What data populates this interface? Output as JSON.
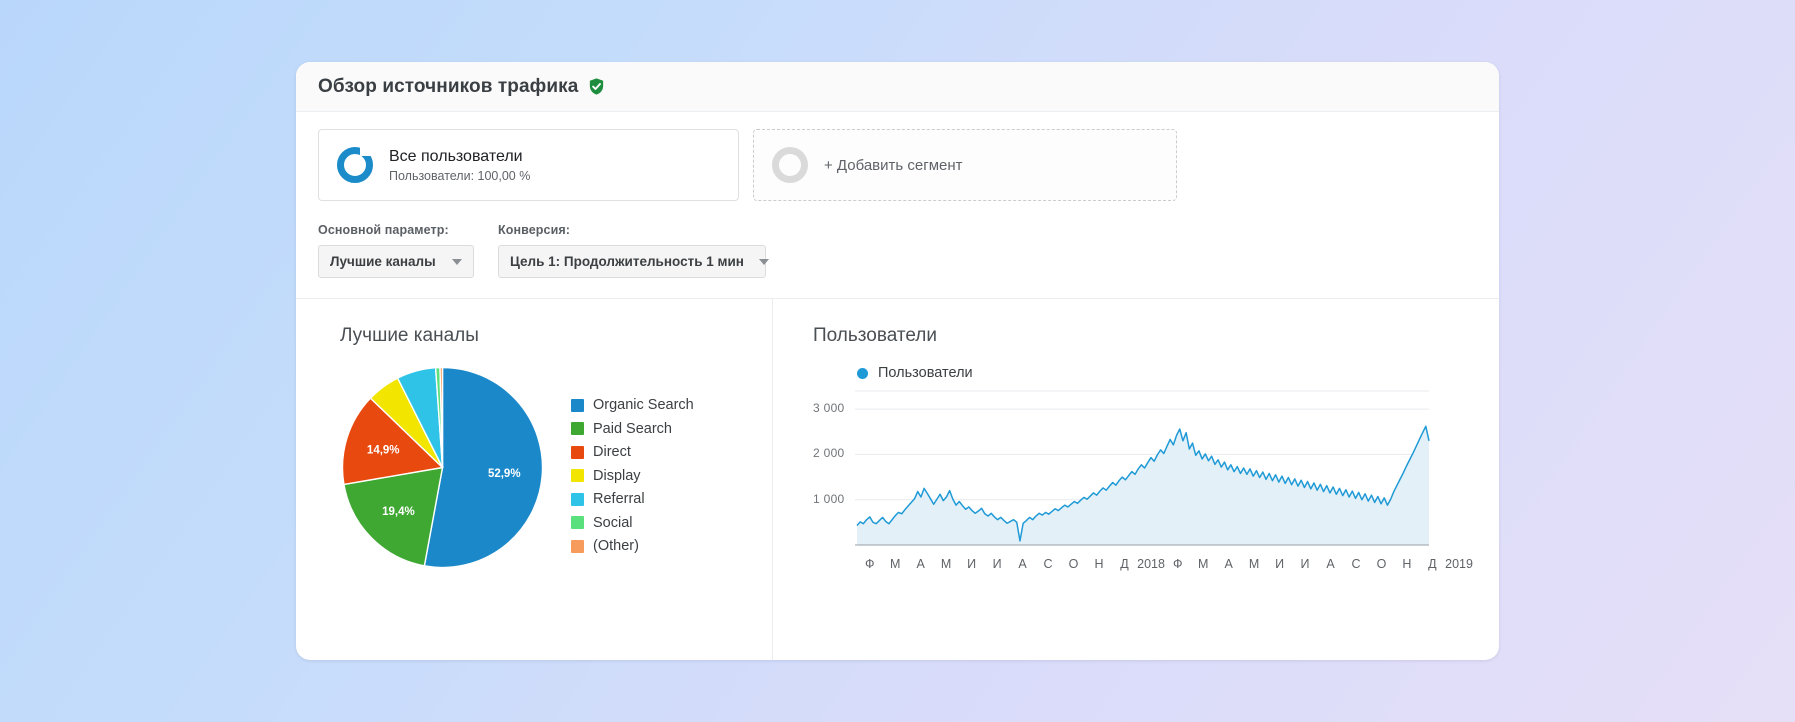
{
  "header": {
    "title": "Обзор источников трафика",
    "badge_icon": "verified-shield-icon",
    "badge_color": "#1e8e3e"
  },
  "segments": [
    {
      "name": "Все пользователи",
      "subtitle": "Пользователи: 100,00 %",
      "icon": "donut-chart-icon",
      "color": "#1b8bc9"
    },
    {
      "add_label": "+ Добавить сегмент",
      "icon": "donut-chart-icon",
      "color": "#dadada"
    }
  ],
  "controls": {
    "primary": {
      "label": "Основной параметр:",
      "value": "Лучшие каналы",
      "caret_icon": "chevron-down-icon"
    },
    "conversion": {
      "label": "Конверсия:",
      "value": "Цель 1: Продолжительность 1 мин",
      "caret_icon": "chevron-down-icon"
    }
  },
  "panels": {
    "pie_title": "Лучшие каналы",
    "line_title": "Пользователи"
  },
  "chart_data": [
    {
      "type": "pie",
      "title": "Лучшие каналы",
      "legend_position": "right",
      "categories": [
        "Organic Search",
        "Paid Search",
        "Direct",
        "Display",
        "Referral",
        "Social",
        "(Other)"
      ],
      "values": [
        52.9,
        19.4,
        14.9,
        5.4,
        6.3,
        0.7,
        0.4
      ],
      "colors": [
        "#1a88c9",
        "#3fa832",
        "#e8490f",
        "#f2e500",
        "#2fc3e8",
        "#5ae07c",
        "#f79b5c"
      ],
      "value_labels": [
        "52,9%",
        "19,4%",
        "14,9%",
        "",
        "",
        "",
        ""
      ],
      "labels_shown": [
        "52,9%",
        "19,4%",
        "14,9%"
      ]
    },
    {
      "type": "area",
      "title": "Пользователи",
      "legend": [
        "Пользователи"
      ],
      "legend_color": "#1f9ad6",
      "ylabel": "",
      "xlabel": "",
      "ylim": [
        0,
        3400
      ],
      "yticks": [
        "1 000",
        "2 000",
        "3 000"
      ],
      "ytick_values": [
        1000,
        2000,
        3000
      ],
      "grid": true,
      "xticks": [
        "Ф",
        "М",
        "А",
        "М",
        "И",
        "И",
        "А",
        "С",
        "О",
        "Н",
        "Д",
        "2018",
        "Ф",
        "М",
        "А",
        "М",
        "И",
        "И",
        "А",
        "С",
        "О",
        "Н",
        "Д",
        "2019"
      ],
      "series": [
        {
          "name": "Пользователи",
          "values": [
            430,
            510,
            470,
            560,
            620,
            500,
            470,
            540,
            610,
            520,
            470,
            560,
            650,
            720,
            690,
            780,
            860,
            940,
            1020,
            1180,
            1060,
            1250,
            1140,
            1020,
            900,
            1010,
            1120,
            980,
            1060,
            1200,
            1010,
            880,
            960,
            870,
            790,
            840,
            760,
            700,
            750,
            810,
            690,
            640,
            700,
            620,
            560,
            610,
            540,
            480,
            520,
            560,
            500,
            90,
            480,
            540,
            610,
            560,
            640,
            700,
            660,
            720,
            680,
            740,
            800,
            760,
            820,
            880,
            840,
            900,
            960,
            920,
            990,
            1050,
            1010,
            1080,
            1150,
            1100,
            1190,
            1260,
            1210,
            1300,
            1380,
            1320,
            1420,
            1500,
            1440,
            1530,
            1620,
            1560,
            1680,
            1770,
            1700,
            1820,
            1930,
            1850,
            1990,
            2100,
            2020,
            2180,
            2330,
            2210,
            2420,
            2560,
            2300,
            2480,
            2120,
            2250,
            1980,
            2080,
            1900,
            2010,
            1860,
            1960,
            1780,
            1880,
            1720,
            1830,
            1660,
            1770,
            1620,
            1730,
            1580,
            1700,
            1560,
            1680,
            1520,
            1640,
            1490,
            1610,
            1450,
            1580,
            1420,
            1550,
            1390,
            1520,
            1360,
            1490,
            1330,
            1460,
            1300,
            1430,
            1270,
            1400,
            1240,
            1370,
            1210,
            1340,
            1180,
            1310,
            1150,
            1280,
            1120,
            1250,
            1090,
            1220,
            1060,
            1190,
            1030,
            1160,
            1000,
            1130,
            970,
            1100,
            940,
            1070,
            910,
            1040,
            880,
            1010,
            1180,
            1320,
            1460,
            1600,
            1750,
            1890,
            2030,
            2180,
            2330,
            2480,
            2620,
            2300
          ]
        }
      ]
    }
  ]
}
